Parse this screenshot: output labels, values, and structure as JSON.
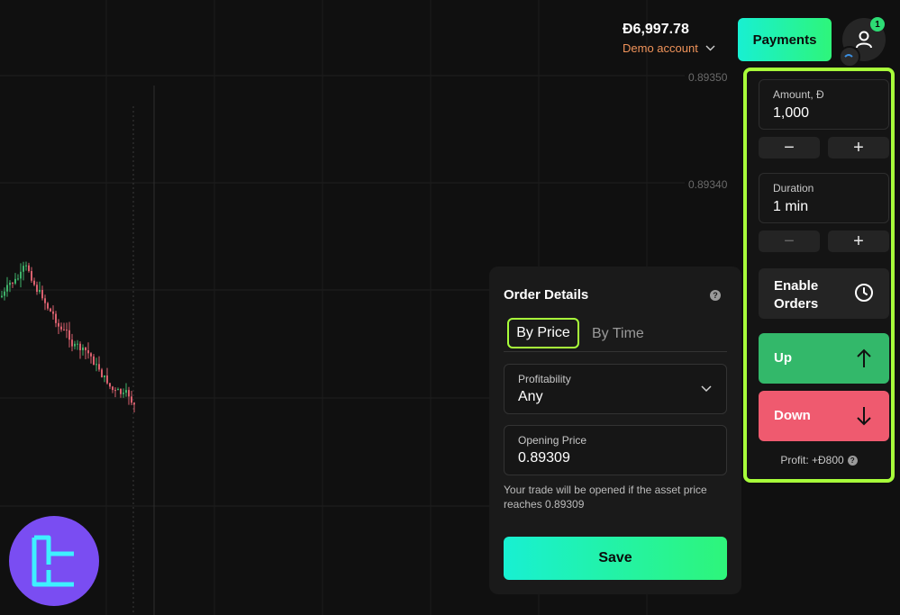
{
  "header": {
    "balance": "Đ6,997.78",
    "account_type": "Demo account",
    "payments_label": "Payments",
    "notification_count": "1"
  },
  "chart": {
    "price_labels": [
      "0.89350",
      "0.89340"
    ]
  },
  "trade_panel": {
    "amount_label": "Amount, Đ",
    "amount_value": "1,000",
    "duration_label": "Duration",
    "duration_value": "1 min",
    "minus_symbol": "−",
    "plus_symbol": "+",
    "enable_orders_label": "Enable Orders",
    "up_label": "Up",
    "down_label": "Down",
    "profit_label": "Profit: +Đ800"
  },
  "order_details": {
    "title": "Order Details",
    "tab_by_price": "By Price",
    "tab_by_time": "By Time",
    "profitability_label": "Profitability",
    "profitability_value": "Any",
    "opening_price_label": "Opening Price",
    "opening_price_value": "0.89309",
    "hint": "Your trade will be opened if the asset price reaches 0.89309",
    "save_label": "Save"
  },
  "colors": {
    "accent_green": "#a8ff3a",
    "up": "#33b86a",
    "down": "#ef5a6f",
    "gradient_start": "#18f0d2",
    "gradient_end": "#2ef57a",
    "logo_bg": "#7a4df2"
  },
  "icons": {
    "user": "user-icon",
    "clock": "clock-icon",
    "arrow_up": "arrow-up-icon",
    "arrow_down": "arrow-down-icon",
    "chevron": "chevron-down-icon",
    "help": "help-icon"
  }
}
